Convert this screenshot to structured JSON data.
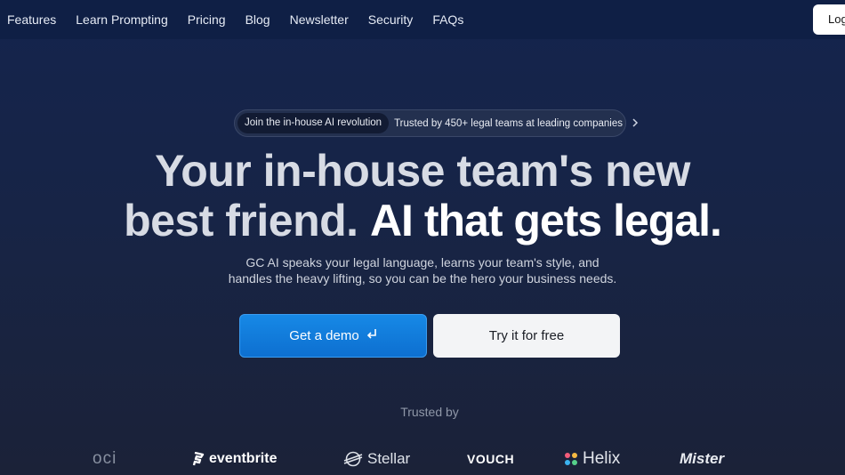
{
  "nav": {
    "items": [
      {
        "label": "Features"
      },
      {
        "label": "Learn Prompting"
      },
      {
        "label": "Pricing"
      },
      {
        "label": "Blog"
      },
      {
        "label": "Newsletter"
      },
      {
        "label": "Security"
      },
      {
        "label": "FAQs"
      }
    ],
    "login_label": "Log"
  },
  "announcement": {
    "tag": "Join the in-house AI revolution",
    "text": "Trusted by 450+ legal teams at leading companies",
    "icon": "chevron-right-icon"
  },
  "hero": {
    "line1": "Your in-house team's new",
    "line2_light": "best friend.",
    "line2_bold": "AI that gets legal.",
    "sub_line1": "GC AI speaks your legal language, learns your team's style, and",
    "sub_line2": "handles the heavy lifting, so you can be the hero your business needs."
  },
  "cta": {
    "demo_label": "Get a demo",
    "demo_icon": "enter-arrow-icon",
    "free_label": "Try it for free"
  },
  "trusted": {
    "label": "Trusted by",
    "logos": [
      {
        "name": "oci"
      },
      {
        "name": "eventbrite"
      },
      {
        "name": "Stellar"
      },
      {
        "name": "VOUCH"
      },
      {
        "name": "Helix"
      },
      {
        "name": "Mister"
      }
    ]
  },
  "colors": {
    "nav_bg": "#0f1f45",
    "primary_button": "#0d6fd0",
    "secondary_button": "#f3f4f6"
  }
}
